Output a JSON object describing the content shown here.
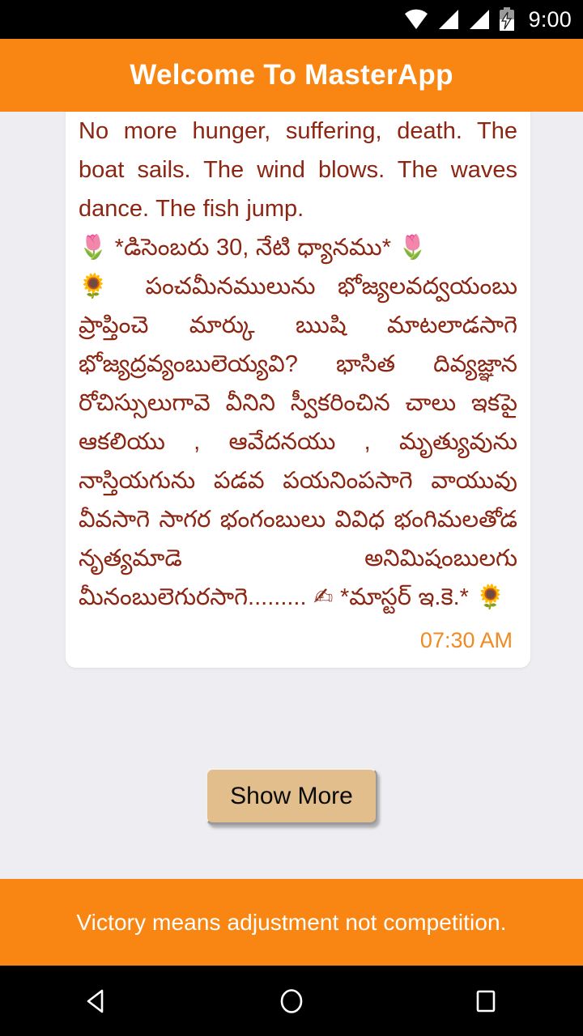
{
  "status_bar": {
    "time": "9:00",
    "icons": [
      "wifi-icon",
      "signal-icon",
      "signal-icon",
      "battery-charging-icon"
    ]
  },
  "app_bar": {
    "title": "Welcome To MasterApp"
  },
  "message_card": {
    "english_text": "Mark speaks. Feed the hosts of wisdom. No more hunger, suffering, death. The boat sails. The wind blows. The waves dance. The fish jump.",
    "telugu_heading": "🌷 *డిసెంబరు 30, నేటి ధ్యానము* 🌷",
    "telugu_body": "🌻  పంచమీనములును భోజ్యలవద్వయంబు ప్రాప్తించె మార్కు ఋషి మాటలాడసాగె భోజ్యద్రవ్యంబులెయ్యవి? భాసిత దివ్యజ్ఞాన రోచిస్సులుగావె వీనిని స్వీకరించిన చాలు ఇకపై ఆకలియు , ఆవేదనయు , మృత్యువును నాస్తియగును పడవ పయనింపసాగె వాయువు వీవసాగె సాగర భంగంబులు వివిధ భంగిమలతోడ నృత్యమాడె అనిమిషంబులగు మీనంబులెగురసాగె......... ✍  *మాస్టర్ ఇ.కె.* 🌻",
    "timestamp": "07:30 AM",
    "text_color": "#8C2512",
    "timestamp_color": "#F08A22"
  },
  "actions": {
    "show_more_label": "Show More",
    "show_more_bg": "#E2BE8C"
  },
  "footer": {
    "quote": "Victory means adjustment not competition.",
    "background": "#F98613"
  },
  "nav_bar": {
    "back_label": "back-nav",
    "home_label": "home-nav",
    "recents_label": "recents-nav"
  },
  "theme": {
    "accent_orange": "#F98613",
    "page_background": "#EEEDF1",
    "card_background": "#FFFFFF"
  }
}
